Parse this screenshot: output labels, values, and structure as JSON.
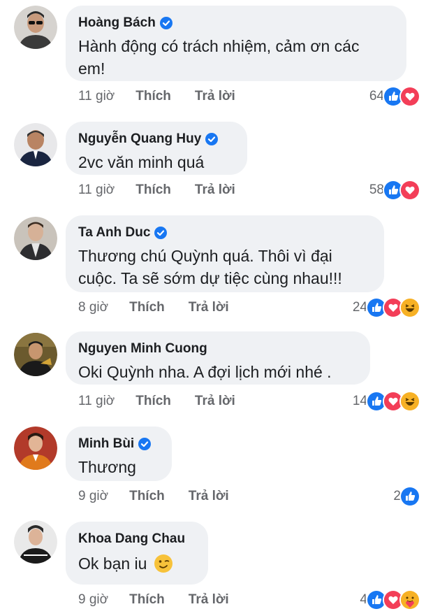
{
  "comments": [
    {
      "name": "Hoàng Bách",
      "verified": true,
      "text_line1": "Hành động có trách nhiệm, cảm ơn các",
      "text_line2": "em!",
      "time": "11 giờ",
      "like": "Thích",
      "reply": "Trả lời",
      "count": "64",
      "reactions": [
        "like",
        "love"
      ]
    },
    {
      "name": "Nguyễn Quang Huy",
      "verified": true,
      "text_line1": "2vc văn minh quá",
      "time": "11 giờ",
      "like": "Thích",
      "reply": "Trả lời",
      "count": "58",
      "reactions": [
        "like",
        "love"
      ]
    },
    {
      "name": "Ta Anh Duc",
      "verified": true,
      "text_line1": "Thương chú Quỳnh quá. Thôi vì đại",
      "text_line2": "cuộc. Ta sẽ sớm dự tiệc cùng nhau!!!",
      "time": "8 giờ",
      "like": "Thích",
      "reply": "Trả lời",
      "count": "24",
      "reactions": [
        "like",
        "love",
        "haha"
      ]
    },
    {
      "name": "Nguyen Minh Cuong",
      "verified": false,
      "text_line1": "Oki Quỳnh nha. A đợi lịch mới nhé .",
      "time": "11 giờ",
      "like": "Thích",
      "reply": "Trả lời",
      "count": "14",
      "reactions": [
        "like",
        "love",
        "haha"
      ]
    },
    {
      "name": "Minh Bùi",
      "verified": true,
      "text_line1": "Thương",
      "time": "9 giờ",
      "like": "Thích",
      "reply": "Trả lời",
      "count": "2",
      "reactions": [
        "like"
      ]
    },
    {
      "name": "Khoa Dang Chau",
      "verified": false,
      "text_line1": "Ok bạn iu",
      "emoji": "wink-emoji",
      "time": "9 giờ",
      "like": "Thích",
      "reply": "Trả lời",
      "count": "4",
      "reactions": [
        "like",
        "love",
        "care"
      ]
    }
  ],
  "colors": {
    "bubble": "#eff1f4",
    "meta": "#65676b",
    "like_blue": "#1877f2",
    "love_red": "#f33e58",
    "haha_yellow": "#f7b125"
  }
}
